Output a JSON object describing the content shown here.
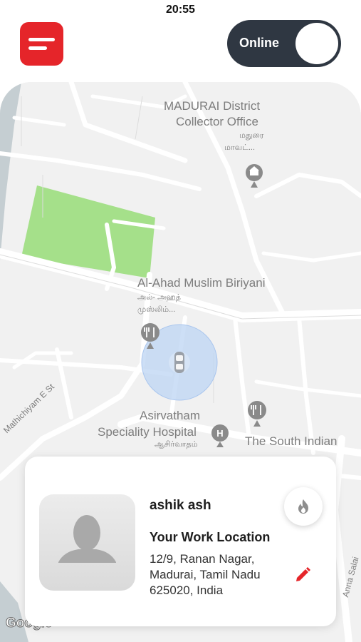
{
  "status_bar": {
    "time": "20:55"
  },
  "header": {
    "online_label": "Online"
  },
  "map": {
    "labels": {
      "collector_line1": "MADURAI District",
      "collector_line2": "Collector Office",
      "collector_tamil1": "மதுரை",
      "collector_tamil2": "மாவட்...",
      "biriyani": "Al-Ahad Muslim Biriyani",
      "biriyani_tamil1": "அல்- அஹத்",
      "biriyani_tamil2": "முஸ்லிம்...",
      "hospital_line1": "Asirvatham",
      "hospital_line2": "Speciality Hospital",
      "hospital_tamil": "ஆசிர்வாதம்",
      "south_indian": "The South Indian",
      "street1": "Mathichiyam E St",
      "street2": "Anna Salai",
      "google": "Google"
    }
  },
  "driver_card": {
    "name": "ashik ash",
    "work_location_title": "Your Work Location",
    "address_lines": [
      "12/9, Ranan Nagar,",
      "Madurai, Tamil Nadu",
      "625020, India"
    ]
  },
  "colors": {
    "accent": "#e5252a",
    "toggle_bg": "#2f3742",
    "park": "#a5e08a"
  }
}
